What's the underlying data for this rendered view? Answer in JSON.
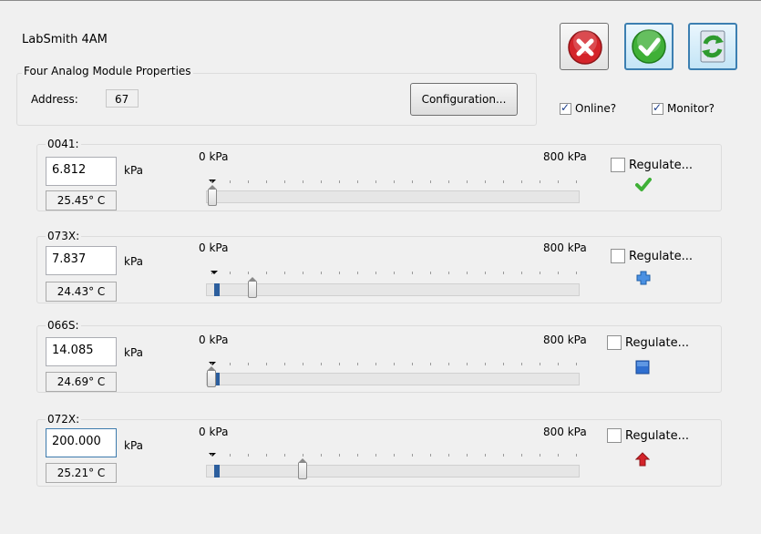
{
  "device": {
    "name": "LabSmith 4AM"
  },
  "properties": {
    "group_title": "Four Analog Module Properties",
    "address_label": "Address:",
    "address_value": "67",
    "configuration_label": "Configuration..."
  },
  "toolbar": {
    "close_icon": "red-x-icon",
    "ok_icon": "green-check-icon",
    "refresh_icon": "green-refresh-icon"
  },
  "options": {
    "online": {
      "label": "Online?",
      "checked": true
    },
    "monitor": {
      "label": "Monitor?",
      "checked": true
    }
  },
  "colors": {
    "accent": "#2c5e9d",
    "ok_green": "#3fb037",
    "error_red": "#d4242a"
  },
  "channels": [
    {
      "name": "0041:",
      "pressure": "6.812",
      "unit": "kPa",
      "temperature": "25.45° C",
      "scale_min": "0 kPa",
      "scale_max": "800 kPa",
      "regulate_label": "Regulate...",
      "regulate_checked": false,
      "status_icon": "green-check-icon",
      "setpoint_kpa": 0,
      "reading_kpa": 6.812
    },
    {
      "name": "073X:",
      "pressure": "7.837",
      "unit": "kPa",
      "temperature": "24.43° C",
      "scale_min": "0 kPa",
      "scale_max": "800 kPa",
      "regulate_label": "Regulate...",
      "regulate_checked": false,
      "status_icon": "blue-plus-icon",
      "setpoint_kpa": 85,
      "reading_kpa": 7.837
    },
    {
      "name": "066S:",
      "pressure": "14.085",
      "unit": "kPa",
      "temperature": "24.69° C",
      "scale_min": "0 kPa",
      "scale_max": "800 kPa",
      "regulate_label": "Regulate...",
      "regulate_checked": false,
      "status_icon": "blue-square-icon",
      "setpoint_kpa": 0,
      "reading_kpa": 14.085
    },
    {
      "name": "072X:",
      "pressure": "200.000",
      "unit": "kPa",
      "temperature": "25.21° C",
      "scale_min": "0 kPa",
      "scale_max": "800 kPa",
      "regulate_label": "Regulate...",
      "regulate_checked": false,
      "status_icon": "red-up-arrow-icon",
      "setpoint_kpa": 200,
      "reading_kpa": 200
    }
  ]
}
